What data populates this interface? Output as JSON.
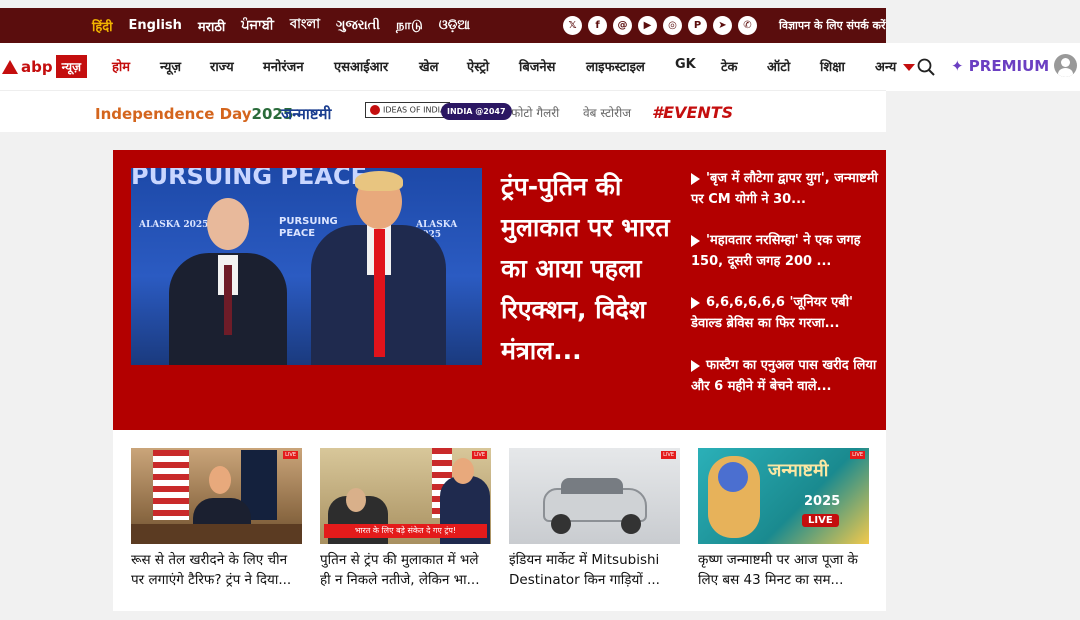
{
  "languages": [
    "हिंदी",
    "English",
    "मराठी",
    "ਪੰਜਾਬੀ",
    "বাংলা",
    "ગુજરાતી",
    "நாடு",
    "ଓଡ଼ିଆ"
  ],
  "social_icons": [
    "x-icon",
    "facebook-icon",
    "threads-icon",
    "youtube-icon",
    "instagram-icon",
    "pinterest-icon",
    "telegram-icon",
    "whatsapp-icon"
  ],
  "advert_link": "विज्ञापन के लिए संपर्क करें",
  "logo": {
    "brand": "abp",
    "news": "न्यूज़"
  },
  "nav": [
    "होम",
    "न्यूज़",
    "राज्य",
    "मनोरंजन",
    "एसआईआर",
    "खेल",
    "ऐस्ट्रो",
    "बिजनेस",
    "लाइफस्टाइल",
    "GK",
    "टेक",
    "ऑटो",
    "शिक्षा",
    "अन्य"
  ],
  "premium": "✦ PREMIUM",
  "subnav": {
    "independence": "Independence Day",
    "independence_year": "2025",
    "janmashtami": "जन्माष्टमी",
    "ideas": "IDEAS OF INDIA",
    "india2047": "INDIA @2047",
    "photo_gallery": "फोटो गैलरी",
    "web_stories": "वेब स्टोरीज",
    "events": "#EVENTS"
  },
  "hero": {
    "title": "ट्रंप-पुतिन की मुलाकात पर भारत का आया पहला रिएक्शन, विदेश मंत्राल...",
    "image_texts": {
      "banner": "PURSUING PEACE",
      "left": "ALASKA 2025",
      "right": "ALASKA 2025",
      "center": "PURSUING PEACE"
    },
    "side_items": [
      "'बृज में लौटेगा द्वापर युग', जन्माष्टमी पर CM योगी ने 30...",
      "'महावतार नरसिम्हा' ने एक जगह 150, दूसरी जगह 200 ...",
      "6,6,6,6,6,6 'जूनियर एबी' डेवाल्ड ब्रेविस का फिर गरजा...",
      "फास्टैग का एनुअल पास खरीद लिया और 6 महीने में बेचने वाले..."
    ]
  },
  "cards": [
    {
      "text": "रूस से तेल खरीदने के लिए चीन पर लगाएंगे टैरिफ? ट्रंप ने दिया...",
      "badge": "LIVE"
    },
    {
      "text": "पुतिन से ट्रंप की मुलाकात में भले ही न निकले नतीजे, लेकिन भा...",
      "badge": "LIVE",
      "caption": "भारत के लिए बड़े संकेत दे गए ट्रंप!"
    },
    {
      "text": "इंडियन मार्केट में Mitsubishi Destinator किन गाड़ियों ...",
      "badge": "LIVE"
    },
    {
      "text": "कृष्ण जन्माष्टमी पर आज पूजा के लिए बस 43 मिनट का सम...",
      "badge": "LIVE",
      "overlay_title": "जन्माष्टमी",
      "overlay_year": "2025",
      "overlay_live": "LIVE"
    }
  ]
}
